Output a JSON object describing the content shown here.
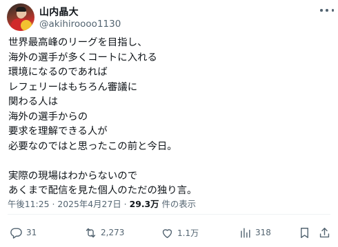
{
  "author": {
    "display_name": "山内晶大",
    "handle": "@akihiroooo1130"
  },
  "post": {
    "lines": [
      "世界最高峰のリーグを目指し、",
      "海外の選手が多くコートに入れる",
      "環境になるのであれば",
      "レフェリーはもちろん審議に",
      "関わる人は",
      "海外の選手からの",
      "要求を理解できる人が",
      "必要なのではと思ったこの前と今日。",
      "",
      "実際の現場はわからないので",
      "あくまで配信を見た個人のただの独り言。"
    ],
    "time": "午後11:25",
    "separator": "·",
    "date": "2025年4月27日",
    "views_count": "29.3万",
    "views_label": "件の表示"
  },
  "actions": {
    "reply_count": "31",
    "repost_count": "2,273",
    "like_count": "1.1万",
    "view_count": "318",
    "icons": [
      "reply-icon",
      "repost-icon",
      "like-icon",
      "analytics-icon",
      "bookmark-icon",
      "share-icon"
    ]
  },
  "colors": {
    "text": "#0f1419",
    "secondary": "#536471",
    "divider": "#eff3f4"
  }
}
